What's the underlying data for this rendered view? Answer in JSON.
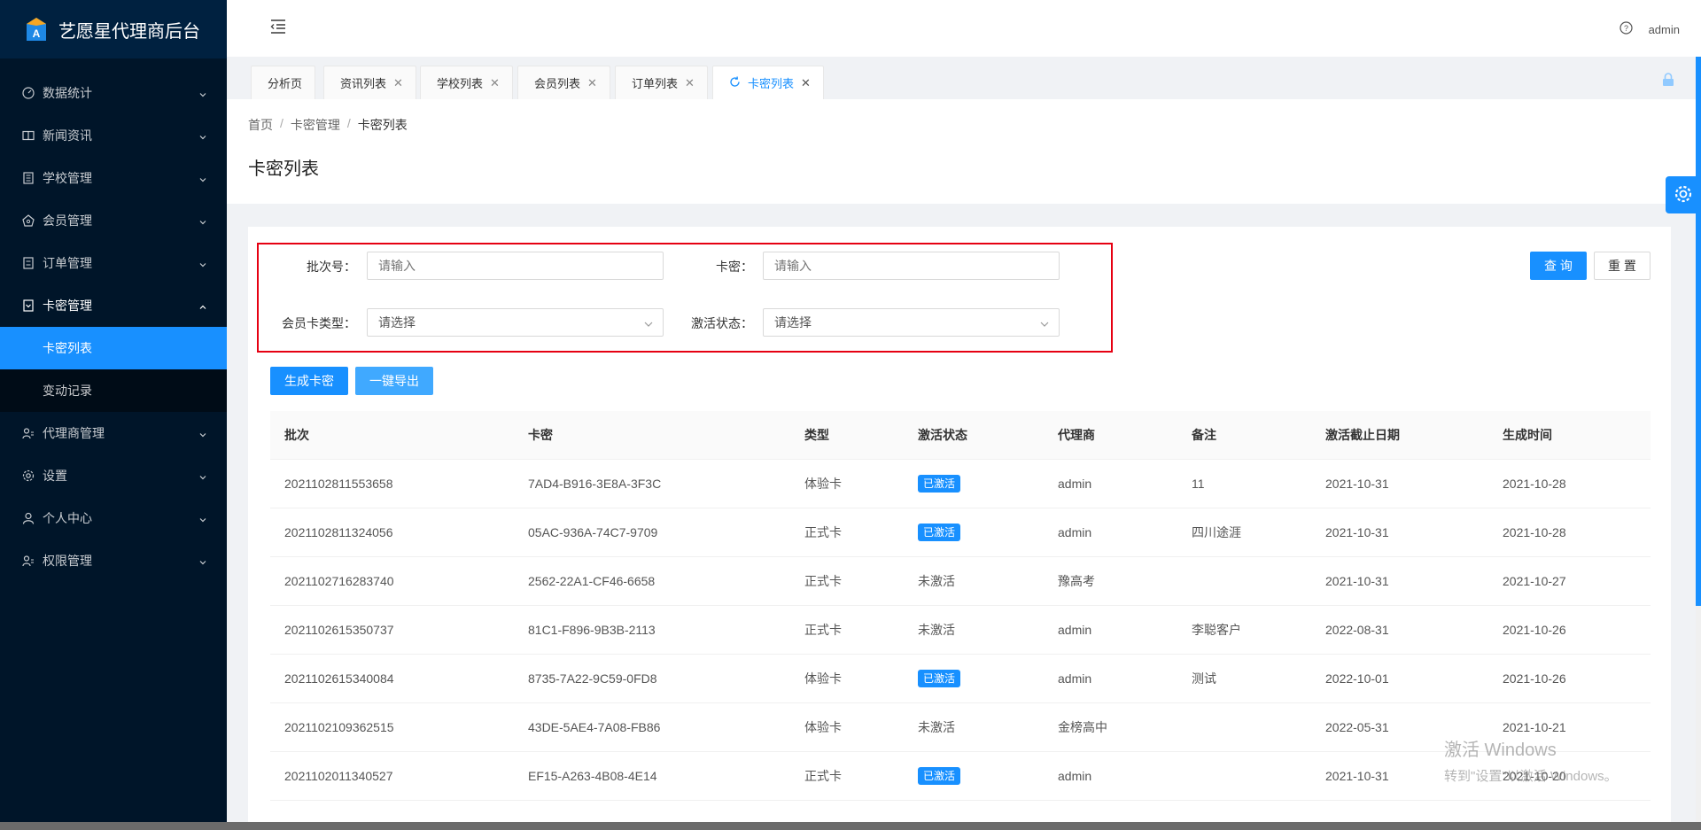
{
  "app": {
    "title": "艺愿星代理商后台"
  },
  "sidebar": {
    "items": [
      {
        "label": "数据统计",
        "icon": "dashboard-icon"
      },
      {
        "label": "新闻资讯",
        "icon": "news-icon"
      },
      {
        "label": "学校管理",
        "icon": "school-icon"
      },
      {
        "label": "会员管理",
        "icon": "member-icon"
      },
      {
        "label": "订单管理",
        "icon": "order-icon"
      },
      {
        "label": "卡密管理",
        "icon": "card-icon"
      },
      {
        "label": "代理商管理",
        "icon": "agent-icon"
      },
      {
        "label": "设置",
        "icon": "gear-icon"
      },
      {
        "label": "个人中心",
        "icon": "user-icon"
      },
      {
        "label": "权限管理",
        "icon": "permission-icon"
      }
    ],
    "card_submenu": [
      {
        "label": "卡密列表"
      },
      {
        "label": "变动记录"
      }
    ]
  },
  "header": {
    "user": "admin"
  },
  "tabs": [
    {
      "label": "分析页"
    },
    {
      "label": "资讯列表"
    },
    {
      "label": "学校列表"
    },
    {
      "label": "会员列表"
    },
    {
      "label": "订单列表"
    },
    {
      "label": "卡密列表"
    }
  ],
  "breadcrumb": [
    "首页",
    "卡密管理",
    "卡密列表"
  ],
  "page": {
    "title": "卡密列表"
  },
  "filters": {
    "batch_label": "批次号：",
    "batch_placeholder": "请输入",
    "card_label": "卡密：",
    "card_placeholder": "请输入",
    "type_label": "会员卡类型：",
    "type_value": "请选择",
    "status_label": "激活状态：",
    "status_value": "请选择"
  },
  "actions": {
    "query": "查 询",
    "reset": "重 置",
    "generate": "生成卡密",
    "export": "一键导出"
  },
  "table": {
    "columns": [
      "批次",
      "卡密",
      "类型",
      "激活状态",
      "代理商",
      "备注",
      "激活截止日期",
      "生成时间"
    ],
    "rows": [
      [
        "2021102811553658",
        "7AD4-B916-3E8A-3F3C",
        "体验卡",
        "已激活",
        "admin",
        "11",
        "2021-10-31",
        "2021-10-28"
      ],
      [
        "2021102811324056",
        "05AC-936A-74C7-9709",
        "正式卡",
        "已激活",
        "admin",
        "四川途涯",
        "2021-10-31",
        "2021-10-28"
      ],
      [
        "2021102716283740",
        "2562-22A1-CF46-6658",
        "正式卡",
        "未激活",
        "豫高考",
        "",
        "2021-10-31",
        "2021-10-27"
      ],
      [
        "2021102615350737",
        "81C1-F896-9B3B-2113",
        "正式卡",
        "未激活",
        "admin",
        "李聪客户",
        "2022-08-31",
        "2021-10-26"
      ],
      [
        "2021102615340084",
        "8735-7A22-9C59-0FD8",
        "体验卡",
        "已激活",
        "admin",
        "测试",
        "2022-10-01",
        "2021-10-26"
      ],
      [
        "2021102109362515",
        "43DE-5AE4-7A08-FB86",
        "体验卡",
        "未激活",
        "金榜高中",
        "",
        "2022-05-31",
        "2021-10-21"
      ],
      [
        "2021102011340527",
        "EF15-A263-4B08-4E14",
        "正式卡",
        "已激活",
        "admin",
        "",
        "2021-10-31",
        "2021-10-20"
      ]
    ],
    "active_status": "已激活"
  },
  "watermark": {
    "line1": "激活 Windows",
    "line2": "转到\"设置\"以激活 Windows。"
  },
  "colors": {
    "primary": "#1890ff",
    "sidebar": "#001529",
    "highlight_border": "#e60012"
  }
}
